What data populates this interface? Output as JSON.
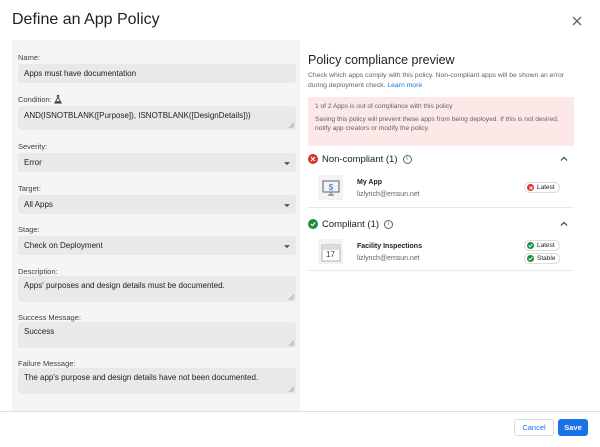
{
  "dialog": {
    "title": "Define an App Policy",
    "close_icon": "close-icon"
  },
  "form": {
    "name": {
      "label": "Name:",
      "value": "Apps must have documentation"
    },
    "condition": {
      "label": "Condition:",
      "icon": "flask-icon",
      "value": "AND(ISNOTBLANK([Purpose]), ISNOTBLANK([DesignDetails]))"
    },
    "severity": {
      "label": "Severity:",
      "value": "Error"
    },
    "target": {
      "label": "Target:",
      "value": "All Apps"
    },
    "stage": {
      "label": "Stage:",
      "value": "Check on Deployment"
    },
    "description": {
      "label": "Description:",
      "value": "Apps' purposes and design details must be documented."
    },
    "success_message": {
      "label": "Success Message:",
      "value": "Success"
    },
    "failure_message": {
      "label": "Failure Message:",
      "value": "The app's purpose and design details have not been documented."
    }
  },
  "preview": {
    "title": "Policy compliance preview",
    "subtitle": "Check which apps comply with this policy. Non-compliant apps will be shown an error during deployment check.",
    "learn_more": "Learn more",
    "alert_line1": "1 of 2 Apps is out of compliance with this policy",
    "alert_line2": "Saving this policy will prevent these apps from being deployed. If this is not desired, notify app creators or modify the policy.",
    "noncompliant": {
      "label": "Non-compliant (1)",
      "color": "#d93025",
      "apps": [
        {
          "name": "My App",
          "owner": "lizlynch@emsun.net",
          "badges": [
            "Latest"
          ]
        }
      ]
    },
    "compliant": {
      "label": "Compliant (1)",
      "color": "#1e8e3e",
      "apps": [
        {
          "name": "Facility Inspections",
          "owner": "lizlynch@emsun.net",
          "calendar_day": "17",
          "badges": [
            "Latest",
            "Stable"
          ]
        }
      ]
    }
  },
  "footer": {
    "cancel_label": "Cancel",
    "save_label": "Save",
    "accent": "#1a73e8"
  }
}
